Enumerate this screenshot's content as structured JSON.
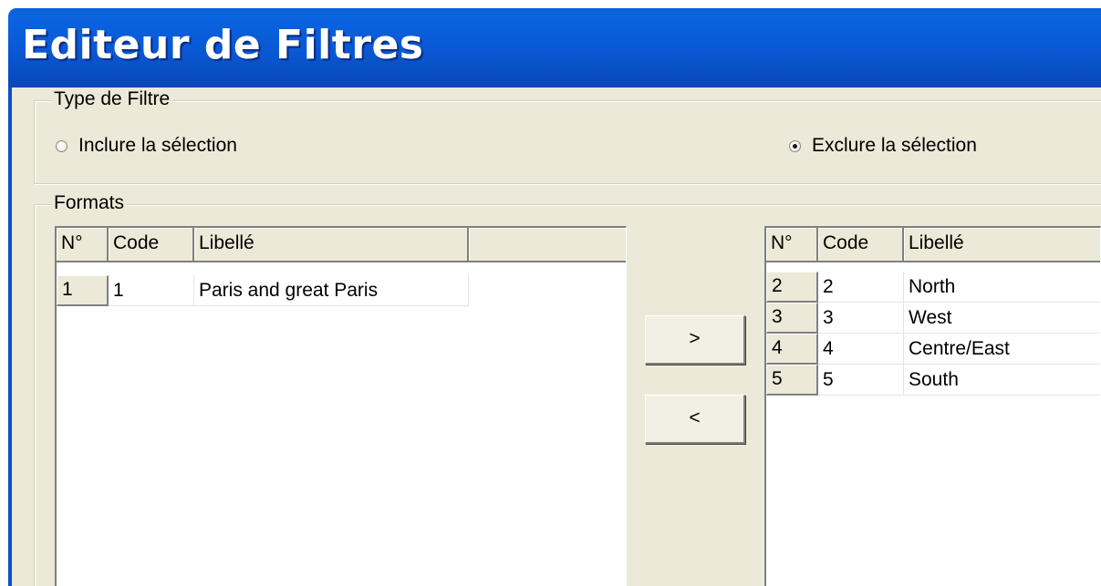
{
  "window": {
    "title": "Editeur de Filtres"
  },
  "filter_type": {
    "label": "Type de Filtre",
    "options": [
      {
        "label": "Inclure la sélection",
        "selected": false
      },
      {
        "label": "Exclure la sélection",
        "selected": true
      }
    ]
  },
  "formats": {
    "label": "Formats",
    "left_list": {
      "columns": [
        "N°",
        "Code",
        "Libellé"
      ],
      "rows": [
        {
          "num": "1",
          "code": "1",
          "label": "Paris and great Paris"
        }
      ]
    },
    "buttons": {
      "move_right": ">",
      "move_left": "<"
    },
    "right_list": {
      "columns": [
        "N°",
        "Code",
        "Libellé"
      ],
      "rows": [
        {
          "num": "2",
          "code": "2",
          "label": "North"
        },
        {
          "num": "3",
          "code": "3",
          "label": "West"
        },
        {
          "num": "4",
          "code": "4",
          "label": "Centre/East"
        },
        {
          "num": "5",
          "code": "5",
          "label": "South"
        }
      ]
    }
  },
  "colors": {
    "titlebar": "#0a59d6",
    "dialog_background": "#ece9d8"
  }
}
